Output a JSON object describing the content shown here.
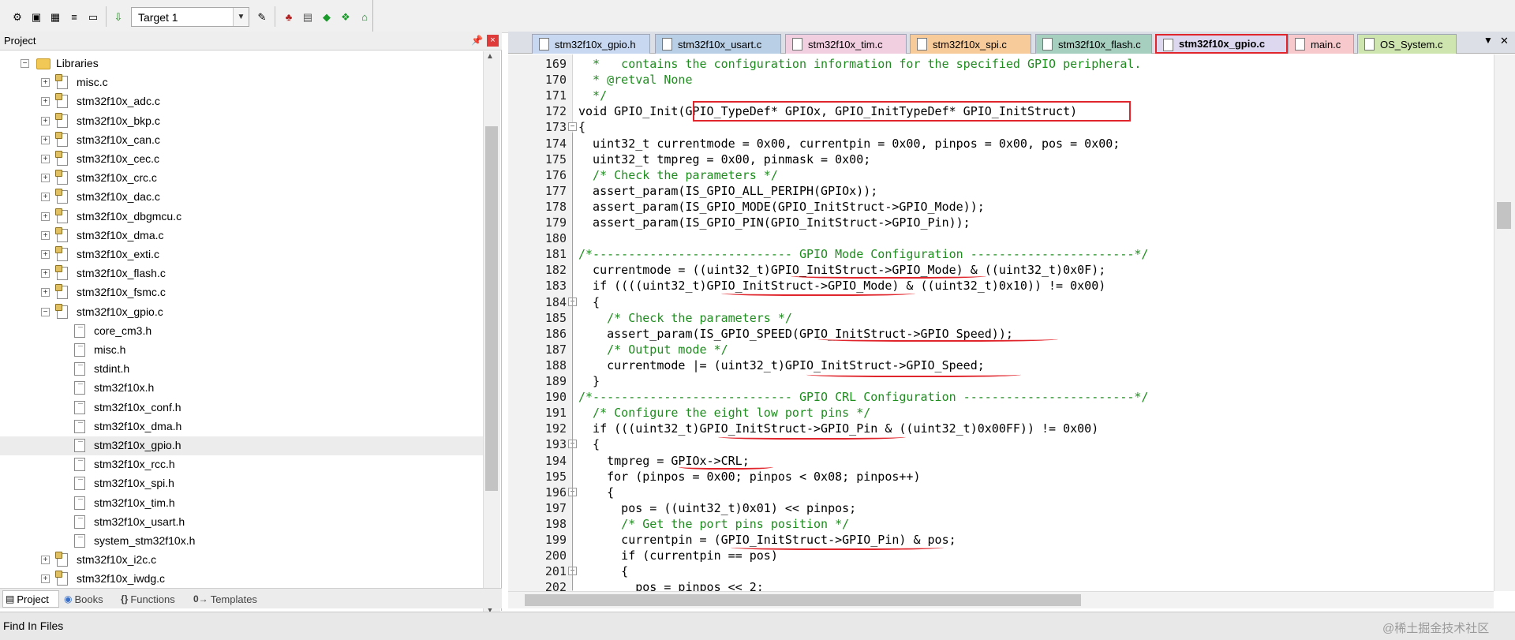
{
  "toolbar": {
    "target": "Target 1",
    "icons": [
      "project-build-icon",
      "translate-icon",
      "rebuild-icon",
      "batch-build-icon",
      "stop-build-icon",
      "download-icon",
      "target-options-icon",
      "manage-components-icon",
      "select-pack-icon",
      "manage-rte-icon",
      "pack-installer-icon",
      "event-recorder-icon"
    ]
  },
  "project_panel": {
    "title": "Project",
    "tree": [
      {
        "label": "Libraries",
        "kind": "folder",
        "level": 0
      },
      {
        "label": "misc.c",
        "kind": "c",
        "level": 1
      },
      {
        "label": "stm32f10x_adc.c",
        "kind": "c",
        "level": 1
      },
      {
        "label": "stm32f10x_bkp.c",
        "kind": "c",
        "level": 1
      },
      {
        "label": "stm32f10x_can.c",
        "kind": "c",
        "level": 1
      },
      {
        "label": "stm32f10x_cec.c",
        "kind": "c",
        "level": 1
      },
      {
        "label": "stm32f10x_crc.c",
        "kind": "c",
        "level": 1
      },
      {
        "label": "stm32f10x_dac.c",
        "kind": "c",
        "level": 1
      },
      {
        "label": "stm32f10x_dbgmcu.c",
        "kind": "c",
        "level": 1
      },
      {
        "label": "stm32f10x_dma.c",
        "kind": "c",
        "level": 1
      },
      {
        "label": "stm32f10x_exti.c",
        "kind": "c",
        "level": 1
      },
      {
        "label": "stm32f10x_flash.c",
        "kind": "c",
        "level": 1
      },
      {
        "label": "stm32f10x_fsmc.c",
        "kind": "c",
        "level": 1
      },
      {
        "label": "stm32f10x_gpio.c",
        "kind": "c-open",
        "level": 1
      },
      {
        "label": "core_cm3.h",
        "kind": "h",
        "level": 2
      },
      {
        "label": "misc.h",
        "kind": "h",
        "level": 2
      },
      {
        "label": "stdint.h",
        "kind": "h",
        "level": 2
      },
      {
        "label": "stm32f10x.h",
        "kind": "h",
        "level": 2
      },
      {
        "label": "stm32f10x_conf.h",
        "kind": "h",
        "level": 2
      },
      {
        "label": "stm32f10x_dma.h",
        "kind": "h",
        "level": 2
      },
      {
        "label": "stm32f10x_gpio.h",
        "kind": "h",
        "level": 2,
        "selected": true
      },
      {
        "label": "stm32f10x_rcc.h",
        "kind": "h",
        "level": 2
      },
      {
        "label": "stm32f10x_spi.h",
        "kind": "h",
        "level": 2
      },
      {
        "label": "stm32f10x_tim.h",
        "kind": "h",
        "level": 2
      },
      {
        "label": "stm32f10x_usart.h",
        "kind": "h",
        "level": 2
      },
      {
        "label": "system_stm32f10x.h",
        "kind": "h",
        "level": 2
      },
      {
        "label": "stm32f10x_i2c.c",
        "kind": "c",
        "level": 1
      },
      {
        "label": "stm32f10x_iwdg.c",
        "kind": "c",
        "level": 1
      }
    ],
    "tabs": [
      {
        "label": "Project",
        "icon": "▤",
        "active": true
      },
      {
        "label": "Books",
        "icon": "◉"
      },
      {
        "label": "Functions",
        "icon": "{}"
      },
      {
        "label": "Templates",
        "icon": "0→"
      }
    ]
  },
  "editor": {
    "tabs": [
      {
        "label": "stm32f10x_gpio.h",
        "color": "#c8d8f0"
      },
      {
        "label": "stm32f10x_usart.c",
        "color": "#b8cfe6"
      },
      {
        "label": "stm32f10x_tim.c",
        "color": "#f2cfe0"
      },
      {
        "label": "stm32f10x_spi.c",
        "color": "#f8cc9a"
      },
      {
        "label": "stm32f10x_flash.c",
        "color": "#a7cfc0"
      },
      {
        "label": "stm32f10x_gpio.c",
        "color": "#ddd7f0",
        "active": true
      },
      {
        "label": "main.c",
        "color": "#f7c8cc"
      },
      {
        "label": "OS_System.c",
        "color": "#cfe5b0"
      }
    ],
    "lines": [
      {
        "n": "169",
        "text": "  *   contains the configuration information for the specified GPIO peripheral.",
        "cls": "cm"
      },
      {
        "n": "170",
        "text": "  * @retval None",
        "cls": "cm"
      },
      {
        "n": "171",
        "text": "  */",
        "cls": "cm"
      },
      {
        "n": "172",
        "text": "void GPIO_Init(GPIO_TypeDef* GPIOx, GPIO_InitTypeDef* GPIO_InitStruct)",
        "cls": ""
      },
      {
        "n": "173",
        "text": "{",
        "cls": ""
      },
      {
        "n": "174",
        "text": "  uint32_t currentmode = 0x00, currentpin = 0x00, pinpos = 0x00, pos = 0x00;",
        "cls": ""
      },
      {
        "n": "175",
        "text": "  uint32_t tmpreg = 0x00, pinmask = 0x00;",
        "cls": ""
      },
      {
        "n": "176",
        "text": "  /* Check the parameters */",
        "cls": "cm"
      },
      {
        "n": "177",
        "text": "  assert_param(IS_GPIO_ALL_PERIPH(GPIOx));",
        "cls": ""
      },
      {
        "n": "178",
        "text": "  assert_param(IS_GPIO_MODE(GPIO_InitStruct->GPIO_Mode));",
        "cls": ""
      },
      {
        "n": "179",
        "text": "  assert_param(IS_GPIO_PIN(GPIO_InitStruct->GPIO_Pin));",
        "cls": ""
      },
      {
        "n": "180",
        "text": "",
        "cls": ""
      },
      {
        "n": "181",
        "text": "/*---------------------------- GPIO Mode Configuration -----------------------*/",
        "cls": "cm"
      },
      {
        "n": "182",
        "text": "  currentmode = ((uint32_t)GPIO_InitStruct->GPIO_Mode) & ((uint32_t)0x0F);",
        "cls": ""
      },
      {
        "n": "183",
        "text": "  if ((((uint32_t)GPIO_InitStruct->GPIO_Mode) & ((uint32_t)0x10)) != 0x00)",
        "cls": ""
      },
      {
        "n": "184",
        "text": "  {",
        "cls": ""
      },
      {
        "n": "185",
        "text": "    /* Check the parameters */",
        "cls": "cm"
      },
      {
        "n": "186",
        "text": "    assert_param(IS_GPIO_SPEED(GPIO_InitStruct->GPIO_Speed));",
        "cls": ""
      },
      {
        "n": "187",
        "text": "    /* Output mode */",
        "cls": "cm"
      },
      {
        "n": "188",
        "text": "    currentmode |= (uint32_t)GPIO_InitStruct->GPIO_Speed;",
        "cls": ""
      },
      {
        "n": "189",
        "text": "  }",
        "cls": ""
      },
      {
        "n": "190",
        "text": "/*---------------------------- GPIO CRL Configuration ------------------------*/",
        "cls": "cm"
      },
      {
        "n": "191",
        "text": "  /* Configure the eight low port pins */",
        "cls": "cm"
      },
      {
        "n": "192",
        "text": "  if (((uint32_t)GPIO_InitStruct->GPIO_Pin & ((uint32_t)0x00FF)) != 0x00)",
        "cls": ""
      },
      {
        "n": "193",
        "text": "  {",
        "cls": ""
      },
      {
        "n": "194",
        "text": "    tmpreg = GPIOx->CRL;",
        "cls": ""
      },
      {
        "n": "195",
        "text": "    for (pinpos = 0x00; pinpos < 0x08; pinpos++)",
        "cls": ""
      },
      {
        "n": "196",
        "text": "    {",
        "cls": ""
      },
      {
        "n": "197",
        "text": "      pos = ((uint32_t)0x01) << pinpos;",
        "cls": ""
      },
      {
        "n": "198",
        "text": "      /* Get the port pins position */",
        "cls": "cm"
      },
      {
        "n": "199",
        "text": "      currentpin = (GPIO_InitStruct->GPIO_Pin) & pos;",
        "cls": ""
      },
      {
        "n": "200",
        "text": "      if (currentpin == pos)",
        "cls": ""
      },
      {
        "n": "201",
        "text": "      {",
        "cls": ""
      },
      {
        "n": "202",
        "text": "        pos = pinpos << 2;",
        "cls": ""
      }
    ]
  },
  "status_bar": {
    "text": "Find In Files",
    "watermark": "@稀土掘金技术社区"
  }
}
